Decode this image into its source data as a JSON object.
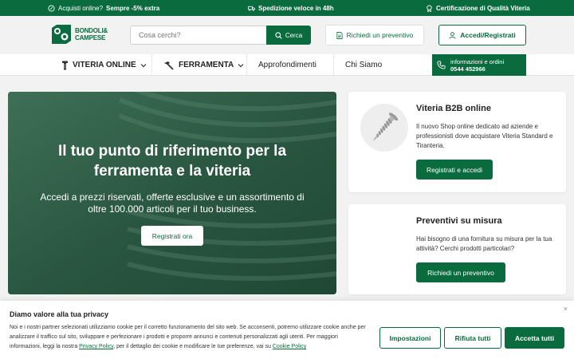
{
  "topbar": {
    "promo_label": "Acquisti online?",
    "promo_bold": "Sempre -5% extra",
    "shipping": "Spedizione veloce in 48h",
    "quality": "Certificazione di Qualità Viteria"
  },
  "header": {
    "logo_line1": "BONDOLI&",
    "logo_line2": "CAMPESE",
    "search_placeholder": "Cosa cerchi?",
    "search_button": "Cerca",
    "quote_button": "Richiedi un preventivo",
    "login_button": "Accedi/Registrati"
  },
  "nav": {
    "items": [
      {
        "label": "VITERIA ONLINE"
      },
      {
        "label": "FERRAMENTA"
      },
      {
        "label": "Approfondimenti"
      },
      {
        "label": "Chi Siamo"
      }
    ],
    "contact_line1": "informazioni e ordini",
    "contact_phone": "0544 452966"
  },
  "hero": {
    "title": "Il tuo punto di riferimento per la ferramenta e la viteria",
    "subtitle": "Accedi a prezzi riservati, offerte esclusive e un assortimento di oltre 100.000 articoli per il tuo business.",
    "button": "Registrati ora"
  },
  "cards": [
    {
      "title": "Viteria B2B online",
      "text": "Il nuovo Shop online dedicato ad aziende e professionisti dove acquistare Viteria Standard e Tiranteria.",
      "button": "Registrati e accedi"
    },
    {
      "title": "Preventivi su misura",
      "text": "Hai bisogno di una fornitura su misura per la tua attività? Cerchi prodotti particolari?",
      "button": "Richiedi un preventivo"
    }
  ],
  "cookie": {
    "title": "Diamo valore alla tua privacy",
    "text_1": "Noi e i nostri partner selezionati utilizziamo cookie per il corretto funzionamento del sito web. Se acconsenti, potremo utilizzare cookie anche per analizzare il traffico sul sito, sviluppare e perfezionare i prodotti e proporre annunci e contenuti personalizzati agli utenti. Per maggiori informazioni, leggi la nostra ",
    "privacy_link": "Privacy Policy",
    "text_2": ", per il dettaglio dei cookie e modificare le tue preferenze, vai su ",
    "cookie_link": "Cookie Policy",
    "close": "×",
    "btn_settings": "Impostazioni",
    "btn_reject": "Rifiuta tutti",
    "btn_accept": "Accetta tutti"
  },
  "colors": {
    "brand_green": "#0a6b3f",
    "background": "#f2f2f2"
  }
}
